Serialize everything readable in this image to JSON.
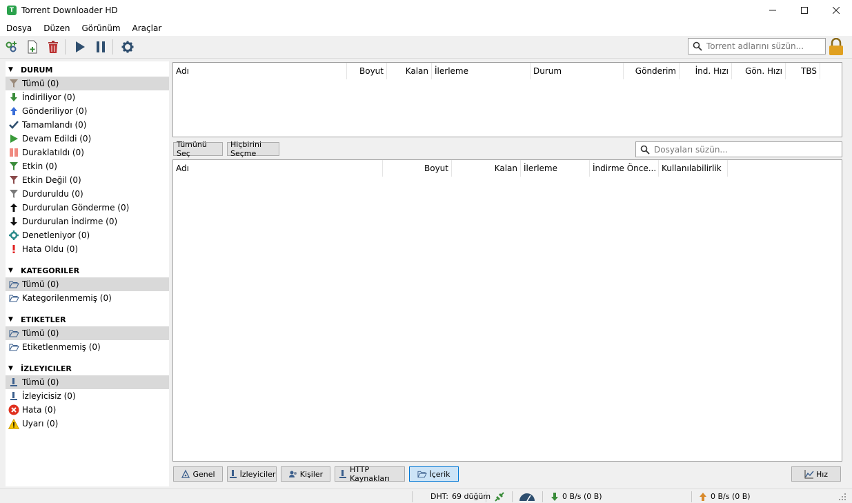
{
  "window": {
    "title": "Torrent Downloader HD",
    "app_icon_letter": "T"
  },
  "menu": [
    "Dosya",
    "Düzen",
    "Görünüm",
    "Araçlar"
  ],
  "toolbar": {
    "search_placeholder": "Torrent adlarını süzün..."
  },
  "sidebar": {
    "status": {
      "title": "DURUM",
      "items": [
        {
          "label": "Tümü (0)",
          "icon": "filter-icon"
        },
        {
          "label": "İndiriliyor (0)",
          "icon": "download-arrow-icon"
        },
        {
          "label": "Gönderiliyor (0)",
          "icon": "upload-arrow-icon"
        },
        {
          "label": "Tamamlandı (0)",
          "icon": "checkmark-icon"
        },
        {
          "label": "Devam Edildi (0)",
          "icon": "play-icon"
        },
        {
          "label": "Duraklatıldı (0)",
          "icon": "pause-icon"
        },
        {
          "label": "Etkin (0)",
          "icon": "filter-active-icon"
        },
        {
          "label": "Etkin Değil (0)",
          "icon": "filter-inactive-icon"
        },
        {
          "label": "Durduruldu (0)",
          "icon": "filter-stopped-icon"
        },
        {
          "label": "Durdurulan Gönderme (0)",
          "icon": "stalled-upload-icon"
        },
        {
          "label": "Durdurulan İndirme (0)",
          "icon": "stalled-download-icon"
        },
        {
          "label": "Denetleniyor (0)",
          "icon": "gear-icon"
        },
        {
          "label": "Hata Oldu (0)",
          "icon": "exclamation-icon"
        }
      ]
    },
    "categories": {
      "title": "KATEGORILER",
      "items": [
        {
          "label": "Tümü (0)",
          "icon": "folder-icon"
        },
        {
          "label": "Kategorilenmemiş (0)",
          "icon": "folder-icon"
        }
      ]
    },
    "tags": {
      "title": "ETIKETLER",
      "items": [
        {
          "label": "Tümü (0)",
          "icon": "folder-icon"
        },
        {
          "label": "Etiketlenmemiş (0)",
          "icon": "folder-icon"
        }
      ]
    },
    "trackers": {
      "title": "İZLEYICILER",
      "items": [
        {
          "label": "Tümü (0)",
          "icon": "tracker-icon"
        },
        {
          "label": "İzleyicisiz (0)",
          "icon": "tracker-icon"
        },
        {
          "label": "Hata (0)",
          "icon": "error-icon"
        },
        {
          "label": "Uyarı (0)",
          "icon": "warning-icon"
        }
      ]
    }
  },
  "torrent_table": {
    "columns": [
      "Adı",
      "Boyut",
      "Kalan",
      "İlerleme",
      "Durum",
      "Gönderim",
      "İnd. Hızı",
      "Gön. Hızı",
      "TBS"
    ]
  },
  "files": {
    "select_all": "Tümünü Seç",
    "select_none": "Hiçbirini Seçme",
    "search_placeholder": "Dosyaları süzün...",
    "columns": [
      "Adı",
      "Boyut",
      "Kalan",
      "İlerleme",
      "İndirme Önce...",
      "Kullanılabilirlik"
    ]
  },
  "tabs": {
    "general": "Genel",
    "trackers": "İzleyiciler",
    "peers": "Kişiler",
    "http": "HTTP Kaynakları",
    "content": "İçerik",
    "speed": "Hız"
  },
  "status": {
    "dht_label": "DHT:",
    "dht_value": "69 düğüm",
    "download": "0 B/s (0 B)",
    "upload": "0 B/s (0 B)"
  },
  "colors": {
    "accent": "#0078d7",
    "down_green": "#3a8c3a",
    "up_orange": "#d98a2b"
  }
}
